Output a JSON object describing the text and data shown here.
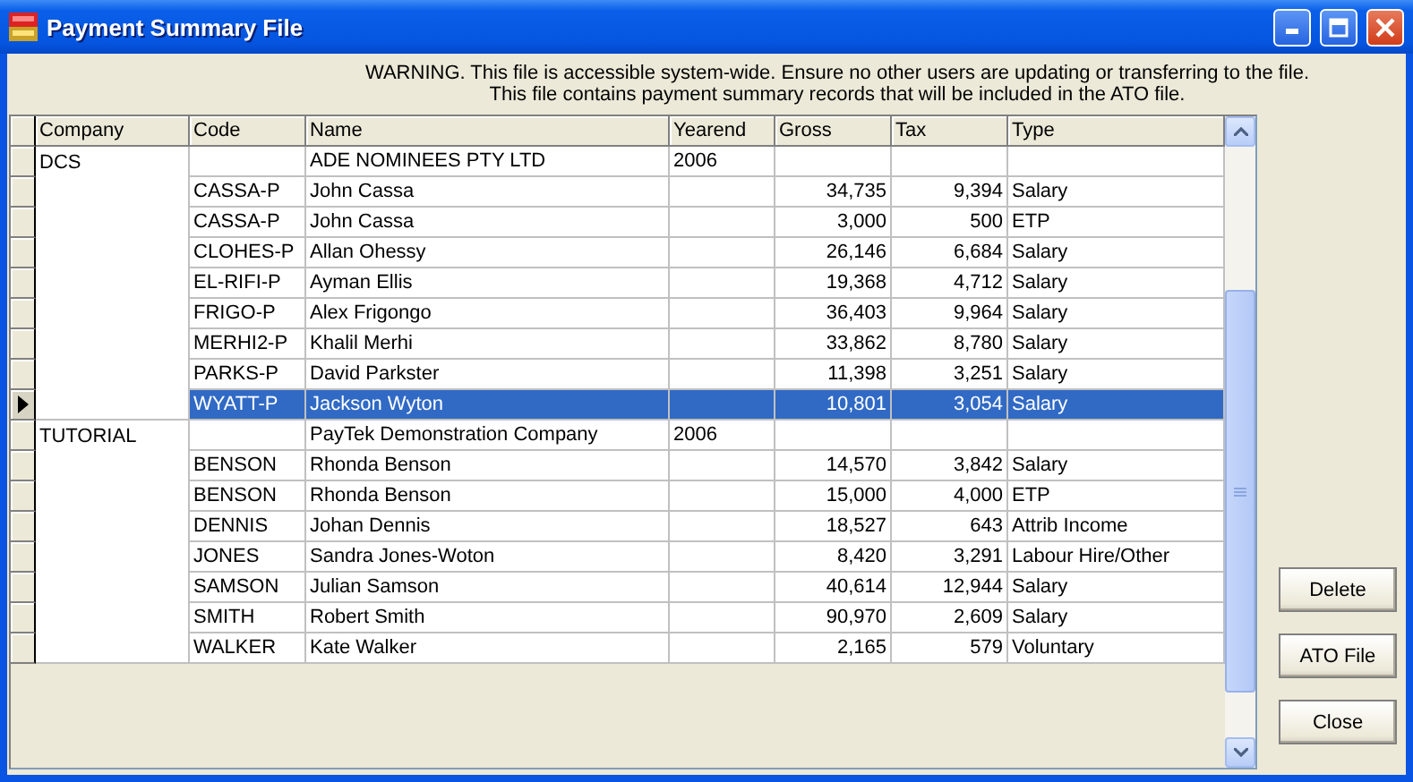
{
  "window": {
    "title": "Payment Summary File"
  },
  "warning": [
    "WARNING. This file is accessible system-wide. Ensure no other users are updating or transferring to the file.",
    "This file contains payment summary records that will be included in the ATO file."
  ],
  "table": {
    "columns": [
      "Company",
      "Code",
      "Name",
      "Yearend",
      "Gross",
      "Tax",
      "Type"
    ],
    "rows": [
      {
        "company": "DCS",
        "name": "ADE NOMINEES PTY LTD",
        "yearend": "2006",
        "selected": false
      },
      {
        "code": "CASSA-P",
        "name": "John Cassa",
        "gross": "34,735",
        "tax": "9,394",
        "type": "Salary",
        "selected": false
      },
      {
        "code": "CASSA-P",
        "name": "John Cassa",
        "gross": "3,000",
        "tax": "500",
        "type": "ETP",
        "selected": false
      },
      {
        "code": "CLOHES-P",
        "name": "Allan Ohessy",
        "gross": "26,146",
        "tax": "6,684",
        "type": "Salary",
        "selected": false
      },
      {
        "code": "EL-RIFI-P",
        "name": "Ayman Ellis",
        "gross": "19,368",
        "tax": "4,712",
        "type": "Salary",
        "selected": false
      },
      {
        "code": "FRIGO-P",
        "name": "Alex Frigongo",
        "gross": "36,403",
        "tax": "9,964",
        "type": "Salary",
        "selected": false
      },
      {
        "code": "MERHI2-P",
        "name": "Khalil Merhi",
        "gross": "33,862",
        "tax": "8,780",
        "type": "Salary",
        "selected": false
      },
      {
        "code": "PARKS-P",
        "name": "David Parkster",
        "gross": "11,398",
        "tax": "3,251",
        "type": "Salary",
        "selected": false
      },
      {
        "code": "WYATT-P",
        "name": "Jackson Wyton",
        "gross": "10,801",
        "tax": "3,054",
        "type": "Salary",
        "selected": true
      },
      {
        "company": "TUTORIAL",
        "name": "PayTek Demonstration Company",
        "yearend": "2006",
        "selected": false
      },
      {
        "code": "BENSON",
        "name": "Rhonda Benson",
        "gross": "14,570",
        "tax": "3,842",
        "type": "Salary",
        "selected": false
      },
      {
        "code": "BENSON",
        "name": "Rhonda Benson",
        "gross": "15,000",
        "tax": "4,000",
        "type": "ETP",
        "selected": false
      },
      {
        "code": "DENNIS",
        "name": "Johan Dennis",
        "gross": "18,527",
        "tax": "643",
        "type": "Attrib Income",
        "selected": false
      },
      {
        "code": "JONES",
        "name": "Sandra Jones-Woton",
        "gross": "8,420",
        "tax": "3,291",
        "type": "Labour Hire/Other",
        "selected": false
      },
      {
        "code": "SAMSON",
        "name": "Julian Samson",
        "gross": "40,614",
        "tax": "12,944",
        "type": "Salary",
        "selected": false
      },
      {
        "code": "SMITH",
        "name": "Robert Smith",
        "gross": "90,970",
        "tax": "2,609",
        "type": "Salary",
        "selected": false
      },
      {
        "code": "WALKER",
        "name": "Kate Walker",
        "gross": "2,165",
        "tax": "579",
        "type": "Voluntary",
        "selected": false
      }
    ]
  },
  "buttons": [
    "Delete",
    "ATO File",
    "Close"
  ]
}
